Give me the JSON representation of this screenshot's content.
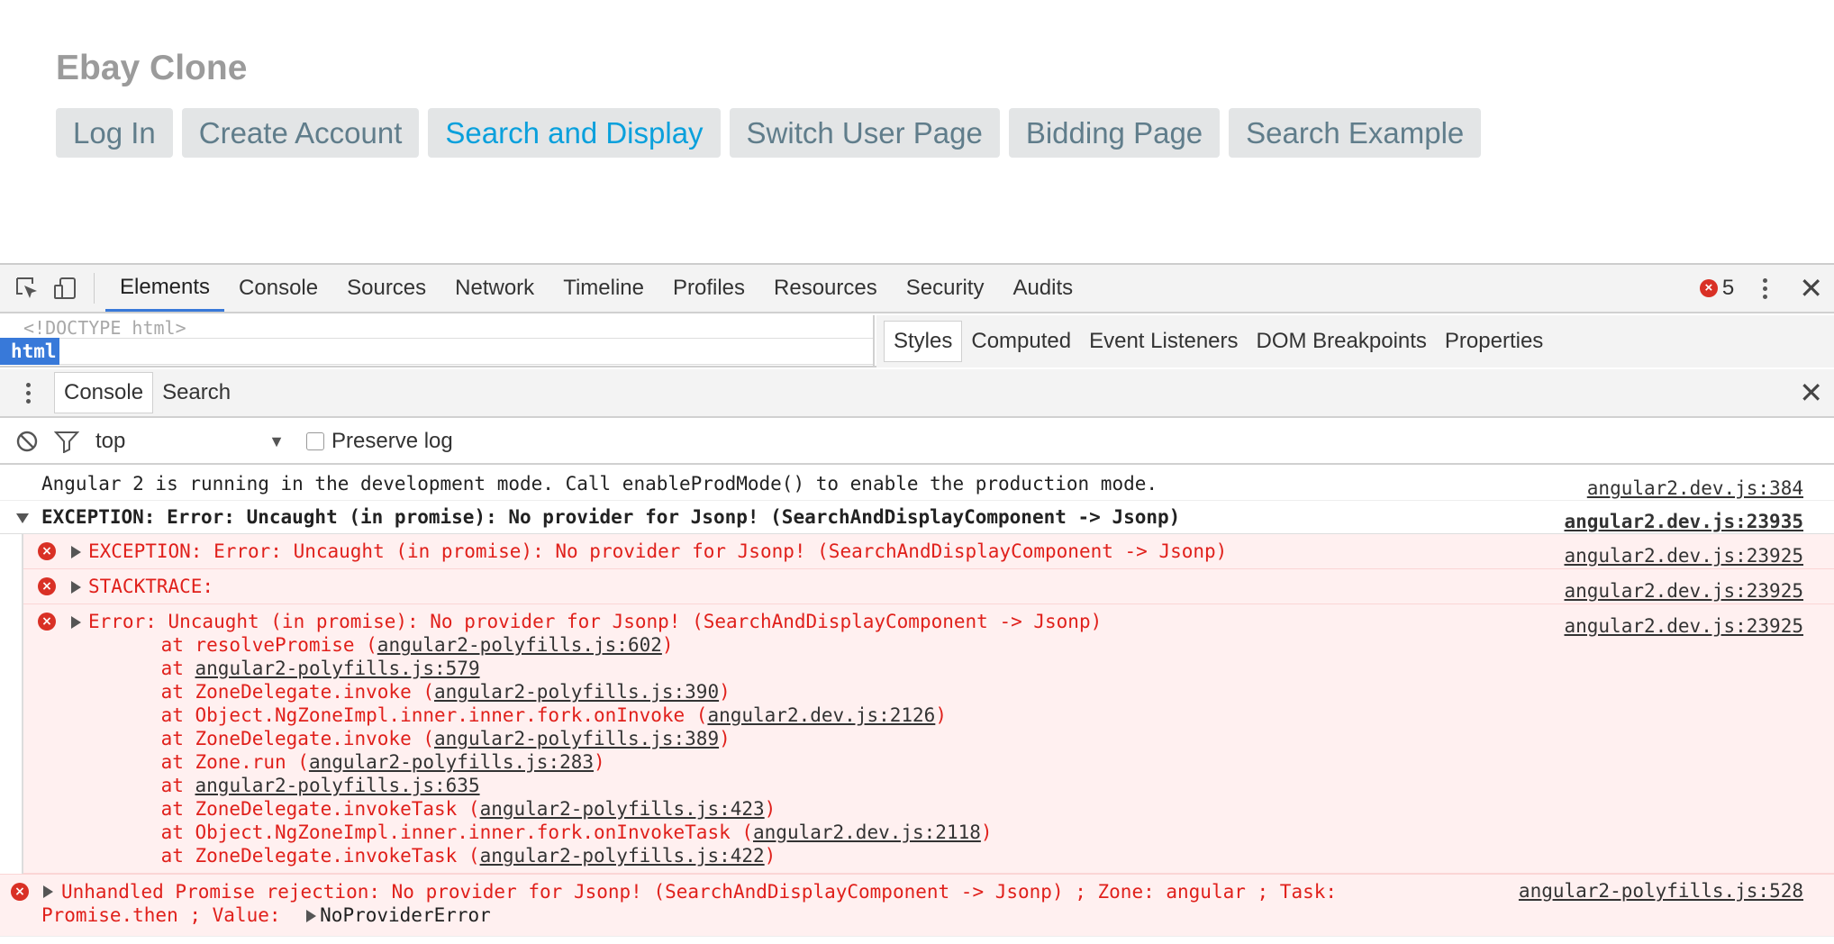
{
  "page": {
    "title": "Ebay Clone",
    "nav": [
      {
        "label": "Log In",
        "active": false
      },
      {
        "label": "Create Account",
        "active": false
      },
      {
        "label": "Search and Display",
        "active": true
      },
      {
        "label": "Switch User Page",
        "active": false
      },
      {
        "label": "Bidding Page",
        "active": false
      },
      {
        "label": "Search Example",
        "active": false
      }
    ]
  },
  "devtools": {
    "tabs": [
      "Elements",
      "Console",
      "Sources",
      "Network",
      "Timeline",
      "Profiles",
      "Resources",
      "Security",
      "Audits"
    ],
    "active_tab": "Elements",
    "error_count": "5",
    "elements": {
      "doctype": "<!DOCTYPE html>",
      "selected_node": "html"
    },
    "styles_tabs": [
      "Styles",
      "Computed",
      "Event Listeners",
      "DOM Breakpoints",
      "Properties"
    ],
    "drawer_tabs": [
      "Console",
      "Search"
    ],
    "console": {
      "context": "top",
      "preserve_log_label": "Preserve log",
      "preserve_log_checked": false,
      "messages": {
        "info": {
          "text": "Angular 2 is running in the development mode. Call enableProdMode() to enable the production mode.",
          "source": "angular2.dev.js:384"
        },
        "group": {
          "text": "EXCEPTION: Error: Uncaught (in promise): No provider for Jsonp! (SearchAndDisplayComponent -> Jsonp)",
          "source": "angular2.dev.js:23935"
        },
        "err1": {
          "text": "EXCEPTION: Error: Uncaught (in promise): No provider for Jsonp! (SearchAndDisplayComponent -> Jsonp)",
          "source": "angular2.dev.js:23925"
        },
        "err2": {
          "text": "STACKTRACE:",
          "source": "angular2.dev.js:23925"
        },
        "err3": {
          "text": "Error: Uncaught (in promise): No provider for Jsonp! (SearchAndDisplayComponent -> Jsonp)",
          "source": "angular2.dev.js:23925"
        },
        "stack": [
          {
            "prefix": "    at resolvePromise (",
            "link": "angular2-polyfills.js:602",
            "suffix": ")"
          },
          {
            "prefix": "    at ",
            "link": "angular2-polyfills.js:579",
            "suffix": ""
          },
          {
            "prefix": "    at ZoneDelegate.invoke (",
            "link": "angular2-polyfills.js:390",
            "suffix": ")"
          },
          {
            "prefix": "    at Object.NgZoneImpl.inner.inner.fork.onInvoke (",
            "link": "angular2.dev.js:2126",
            "suffix": ")"
          },
          {
            "prefix": "    at ZoneDelegate.invoke (",
            "link": "angular2-polyfills.js:389",
            "suffix": ")"
          },
          {
            "prefix": "    at Zone.run (",
            "link": "angular2-polyfills.js:283",
            "suffix": ")"
          },
          {
            "prefix": "    at ",
            "link": "angular2-polyfills.js:635",
            "suffix": ""
          },
          {
            "prefix": "    at ZoneDelegate.invokeTask (",
            "link": "angular2-polyfills.js:423",
            "suffix": ")"
          },
          {
            "prefix": "    at Object.NgZoneImpl.inner.inner.fork.onInvokeTask (",
            "link": "angular2.dev.js:2118",
            "suffix": ")"
          },
          {
            "prefix": "    at ZoneDelegate.invokeTask (",
            "link": "angular2-polyfills.js:422",
            "suffix": ")"
          }
        ],
        "unhandled": {
          "line1": "Unhandled Promise rejection: No provider for Jsonp! (SearchAndDisplayComponent -> Jsonp) ; Zone: angular ; Task:",
          "line2": "Promise.then ; Value: ",
          "value": "NoProviderError",
          "source": "angular2-polyfills.js:528"
        }
      }
    }
  }
}
